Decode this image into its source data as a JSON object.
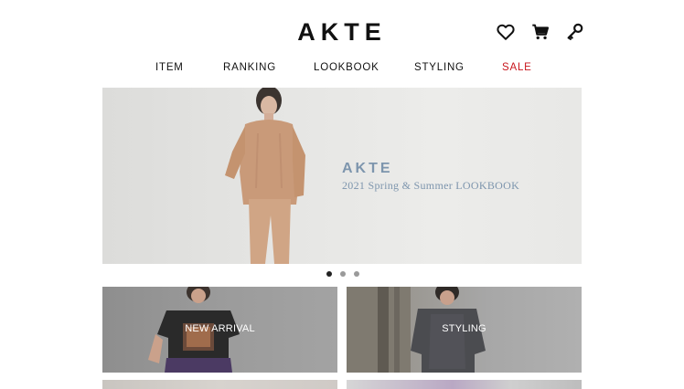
{
  "brand": {
    "logo_text": "AKTE"
  },
  "header": {
    "icons": [
      "heart-icon",
      "cart-icon",
      "key-icon"
    ]
  },
  "nav": {
    "items": [
      {
        "label": "ITEM"
      },
      {
        "label": "RANKING"
      },
      {
        "label": "LOOKBOOK"
      },
      {
        "label": "STYLING"
      },
      {
        "label": "SALE",
        "color": "#c8161d"
      }
    ]
  },
  "hero": {
    "brand": "AKTE",
    "caption": "2021 Spring & Summer LOOKBOOK",
    "text_color": "#7d95ad"
  },
  "carousel": {
    "slide_count": 3,
    "active_index": 0
  },
  "tiles": [
    {
      "label": "NEW ARRIVAL"
    },
    {
      "label": "STYLING"
    }
  ]
}
